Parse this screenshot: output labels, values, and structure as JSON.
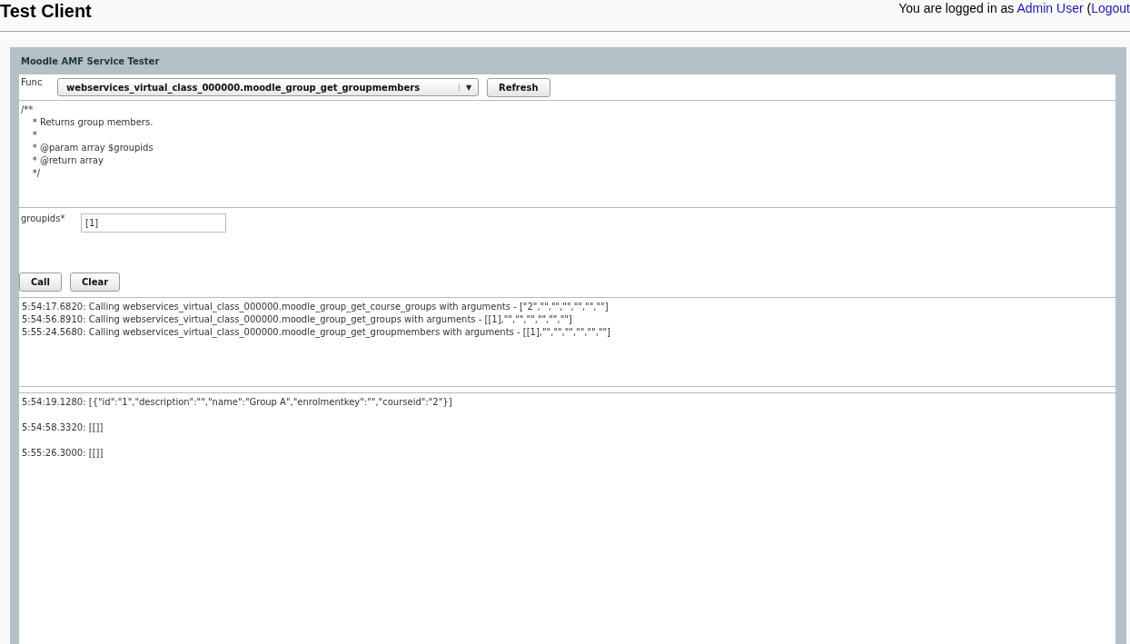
{
  "page_title": "Test Client",
  "login": {
    "prefix": "You are logged in as",
    "user_link": "Admin User",
    "open_paren": "(",
    "logout_link": "Logout"
  },
  "panel": {
    "title": "Moodle AMF Service Tester"
  },
  "func": {
    "label": "Func",
    "value": "webservices_virtual_class_000000.moodle_group_get_groupmembers",
    "dropdown_arrow": "▼",
    "refresh_button": "Refresh"
  },
  "doc_comment": [
    "/**",
    "    * Returns group members.",
    "    *",
    "    * @param array $groupids",
    "    * @return array",
    "    */"
  ],
  "params": [
    {
      "label": "groupids*",
      "value": "[1]"
    }
  ],
  "buttons": [
    "Call",
    "Clear"
  ],
  "call_log": [
    "5:54:17.6820: Calling webservices_virtual_class_000000.moodle_group_get_course_groups with arguments - [\"2\",\"\",\"\",\"\",\"\",\"\",\"\"]",
    "5:54:56.8910: Calling webservices_virtual_class_000000.moodle_group_get_groups with arguments - [[1],\"\",\"\",\"\",\"\",\"\",\"\"]",
    "5:55:24.5680: Calling webservices_virtual_class_000000.moodle_group_get_groupmembers with arguments - [[1],\"\",\"\",\"\",\"\",\"\",\"\"]"
  ],
  "results": [
    "5:54:19.1280: [{\"id\":\"1\",\"description\":\"\",\"name\":\"Group A\",\"enrolmentkey\":\"\",\"courseid\":\"2\"}]",
    "5:54:58.3320: [[]]",
    "5:55:26.3000: [[]]"
  ]
}
